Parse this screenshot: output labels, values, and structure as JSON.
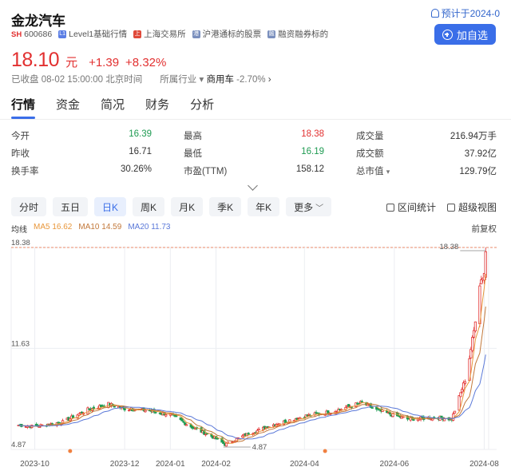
{
  "stock": {
    "name": "金龙汽车",
    "market": "SH",
    "code": "600686",
    "tags": [
      "Level1基础行情",
      "上海交易所",
      "沪港通标的股票",
      "融资融券标的"
    ],
    "notice": "预计于2024-0",
    "add_button": "加自选"
  },
  "quote": {
    "price": "18.10",
    "unit": "元",
    "change": "+1.39",
    "change_pct": "+8.32%",
    "status": "已收盘 08-02 15:00:00 北京时间",
    "industry_label": "所属行业",
    "industry": "商用车",
    "industry_change": "-2.70%"
  },
  "tabs": [
    "行情",
    "资金",
    "简况",
    "财务",
    "分析"
  ],
  "stats": [
    [
      {
        "label": "今开",
        "value": "16.39",
        "tone": "green"
      },
      {
        "label": "最高",
        "value": "18.38",
        "tone": "red"
      },
      {
        "label": "成交量",
        "value": "216.94万手",
        "tone": "normal"
      }
    ],
    [
      {
        "label": "昨收",
        "value": "16.71",
        "tone": "normal"
      },
      {
        "label": "最低",
        "value": "16.19",
        "tone": "green"
      },
      {
        "label": "成交额",
        "value": "37.92亿",
        "tone": "normal"
      }
    ],
    [
      {
        "label": "换手率",
        "value": "30.26%",
        "tone": "normal"
      },
      {
        "label": "市盈(TTM)",
        "value": "158.12",
        "tone": "normal"
      },
      {
        "label": "总市值",
        "value": "129.79亿",
        "tone": "normal"
      }
    ]
  ],
  "periods": [
    "分时",
    "五日",
    "日K",
    "周K",
    "月K",
    "季K",
    "年K",
    "更多"
  ],
  "active_period": "日K",
  "tools": [
    "区间统计",
    "超级视图"
  ],
  "ma": {
    "title": "均线",
    "ma5": "MA5 16.62",
    "ma10": "MA10 14.59",
    "ma20": "MA20 11.73",
    "adjust": "前复权"
  },
  "colors": {
    "up": "#e23030",
    "down": "#1e9b52",
    "accent": "#3a6ee8",
    "ma5": "#e8963a",
    "ma10": "#c2783a",
    "ma20": "#5a78d8"
  },
  "chart_data": {
    "type": "candlestick",
    "y_ticks": [
      "18.38",
      "11.63",
      "4.87"
    ],
    "x_ticks": [
      "2023-10",
      "2023-12",
      "2024-01",
      "2024-02",
      "2024-04",
      "2024-06",
      "2024-08"
    ],
    "ylim": [
      4.87,
      18.38
    ],
    "high_marker": "18.38",
    "low_marker": "4.87",
    "close_path": [
      {
        "date": "2023-09-20",
        "close": 6.5
      },
      {
        "date": "2023-10-01",
        "close": 6.4
      },
      {
        "date": "2023-10-20",
        "close": 6.7
      },
      {
        "date": "2023-11-05",
        "close": 7.5
      },
      {
        "date": "2023-11-20",
        "close": 7.9
      },
      {
        "date": "2023-12-01",
        "close": 7.6
      },
      {
        "date": "2023-12-15",
        "close": 7.5
      },
      {
        "date": "2024-01-01",
        "close": 7.2
      },
      {
        "date": "2024-01-15",
        "close": 6.4
      },
      {
        "date": "2024-02-01",
        "close": 5.6
      },
      {
        "date": "2024-02-07",
        "close": 5.2
      },
      {
        "date": "2024-02-20",
        "close": 5.8
      },
      {
        "date": "2024-03-10",
        "close": 6.5
      },
      {
        "date": "2024-04-01",
        "close": 7.1
      },
      {
        "date": "2024-04-20",
        "close": 7.4
      },
      {
        "date": "2024-05-10",
        "close": 8.0
      },
      {
        "date": "2024-05-20",
        "close": 7.5
      },
      {
        "date": "2024-06-10",
        "close": 6.9
      },
      {
        "date": "2024-07-01",
        "close": 7.0
      },
      {
        "date": "2024-07-10",
        "close": 6.9
      },
      {
        "date": "2024-07-20",
        "close": 9.8
      },
      {
        "date": "2024-07-25",
        "close": 12.8
      },
      {
        "date": "2024-07-29",
        "close": 16.0
      },
      {
        "date": "2024-08-01",
        "close": 16.7
      },
      {
        "date": "2024-08-02",
        "close": 18.1
      }
    ],
    "ma5_last": 16.62,
    "ma10_last": 14.59,
    "ma20_last": 11.73
  }
}
